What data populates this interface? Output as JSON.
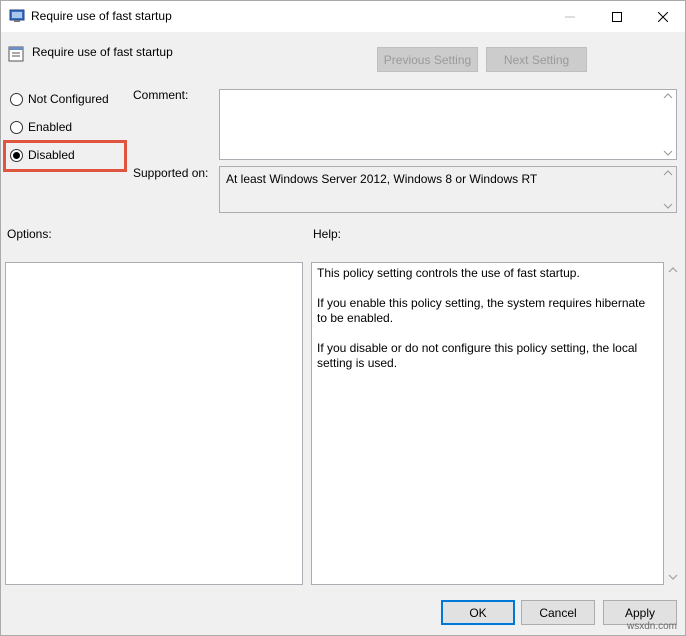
{
  "window": {
    "title": "Require use of fast startup",
    "policy_title": "Require use of fast startup"
  },
  "nav": {
    "previous_label": "Previous Setting",
    "next_label": "Next Setting"
  },
  "state": {
    "options": [
      {
        "label": "Not Configured",
        "checked": false
      },
      {
        "label": "Enabled",
        "checked": false
      },
      {
        "label": "Disabled",
        "checked": true
      }
    ]
  },
  "fields": {
    "comment_label": "Comment:",
    "comment_value": "",
    "supported_label": "Supported on:",
    "supported_value": "At least Windows Server 2012, Windows 8 or Windows RT"
  },
  "panes": {
    "options_label": "Options:",
    "help_label": "Help:",
    "help_paragraphs": [
      "This policy setting controls the use of fast startup.",
      "If you enable this policy setting, the system requires hibernate to be enabled.",
      "If you disable or do not configure this policy setting, the local setting is used."
    ]
  },
  "footer": {
    "ok_label": "OK",
    "cancel_label": "Cancel",
    "apply_label": "Apply"
  },
  "watermark": "wsxdn.com",
  "colors": {
    "highlight": "#e05540",
    "accent": "#0078d7"
  }
}
